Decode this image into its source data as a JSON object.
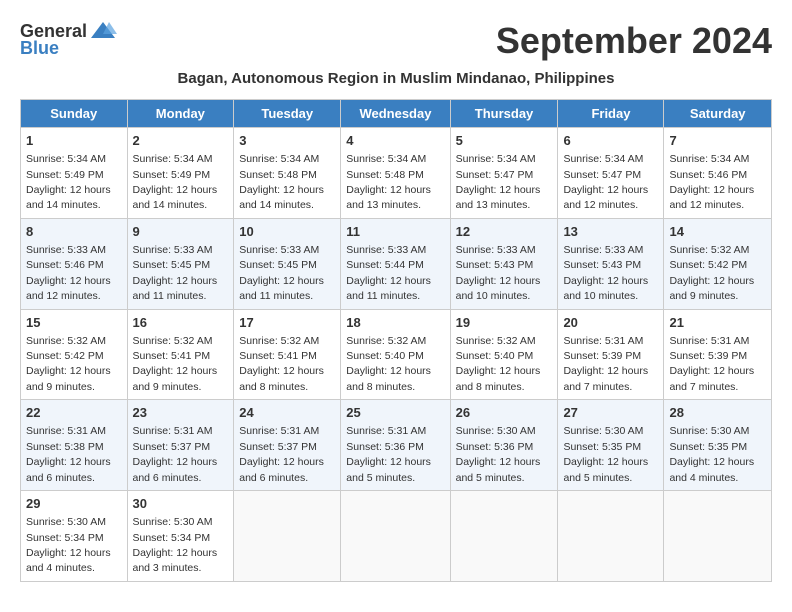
{
  "header": {
    "logo_general": "General",
    "logo_blue": "Blue",
    "month_title": "September 2024",
    "subtitle": "Bagan, Autonomous Region in Muslim Mindanao, Philippines"
  },
  "weekdays": [
    "Sunday",
    "Monday",
    "Tuesday",
    "Wednesday",
    "Thursday",
    "Friday",
    "Saturday"
  ],
  "weeks": [
    [
      {
        "day": "1",
        "sunrise": "Sunrise: 5:34 AM",
        "sunset": "Sunset: 5:49 PM",
        "daylight": "Daylight: 12 hours and 14 minutes."
      },
      {
        "day": "2",
        "sunrise": "Sunrise: 5:34 AM",
        "sunset": "Sunset: 5:49 PM",
        "daylight": "Daylight: 12 hours and 14 minutes."
      },
      {
        "day": "3",
        "sunrise": "Sunrise: 5:34 AM",
        "sunset": "Sunset: 5:48 PM",
        "daylight": "Daylight: 12 hours and 14 minutes."
      },
      {
        "day": "4",
        "sunrise": "Sunrise: 5:34 AM",
        "sunset": "Sunset: 5:48 PM",
        "daylight": "Daylight: 12 hours and 13 minutes."
      },
      {
        "day": "5",
        "sunrise": "Sunrise: 5:34 AM",
        "sunset": "Sunset: 5:47 PM",
        "daylight": "Daylight: 12 hours and 13 minutes."
      },
      {
        "day": "6",
        "sunrise": "Sunrise: 5:34 AM",
        "sunset": "Sunset: 5:47 PM",
        "daylight": "Daylight: 12 hours and 12 minutes."
      },
      {
        "day": "7",
        "sunrise": "Sunrise: 5:34 AM",
        "sunset": "Sunset: 5:46 PM",
        "daylight": "Daylight: 12 hours and 12 minutes."
      }
    ],
    [
      {
        "day": "8",
        "sunrise": "Sunrise: 5:33 AM",
        "sunset": "Sunset: 5:46 PM",
        "daylight": "Daylight: 12 hours and 12 minutes."
      },
      {
        "day": "9",
        "sunrise": "Sunrise: 5:33 AM",
        "sunset": "Sunset: 5:45 PM",
        "daylight": "Daylight: 12 hours and 11 minutes."
      },
      {
        "day": "10",
        "sunrise": "Sunrise: 5:33 AM",
        "sunset": "Sunset: 5:45 PM",
        "daylight": "Daylight: 12 hours and 11 minutes."
      },
      {
        "day": "11",
        "sunrise": "Sunrise: 5:33 AM",
        "sunset": "Sunset: 5:44 PM",
        "daylight": "Daylight: 12 hours and 11 minutes."
      },
      {
        "day": "12",
        "sunrise": "Sunrise: 5:33 AM",
        "sunset": "Sunset: 5:43 PM",
        "daylight": "Daylight: 12 hours and 10 minutes."
      },
      {
        "day": "13",
        "sunrise": "Sunrise: 5:33 AM",
        "sunset": "Sunset: 5:43 PM",
        "daylight": "Daylight: 12 hours and 10 minutes."
      },
      {
        "day": "14",
        "sunrise": "Sunrise: 5:32 AM",
        "sunset": "Sunset: 5:42 PM",
        "daylight": "Daylight: 12 hours and 9 minutes."
      }
    ],
    [
      {
        "day": "15",
        "sunrise": "Sunrise: 5:32 AM",
        "sunset": "Sunset: 5:42 PM",
        "daylight": "Daylight: 12 hours and 9 minutes."
      },
      {
        "day": "16",
        "sunrise": "Sunrise: 5:32 AM",
        "sunset": "Sunset: 5:41 PM",
        "daylight": "Daylight: 12 hours and 9 minutes."
      },
      {
        "day": "17",
        "sunrise": "Sunrise: 5:32 AM",
        "sunset": "Sunset: 5:41 PM",
        "daylight": "Daylight: 12 hours and 8 minutes."
      },
      {
        "day": "18",
        "sunrise": "Sunrise: 5:32 AM",
        "sunset": "Sunset: 5:40 PM",
        "daylight": "Daylight: 12 hours and 8 minutes."
      },
      {
        "day": "19",
        "sunrise": "Sunrise: 5:32 AM",
        "sunset": "Sunset: 5:40 PM",
        "daylight": "Daylight: 12 hours and 8 minutes."
      },
      {
        "day": "20",
        "sunrise": "Sunrise: 5:31 AM",
        "sunset": "Sunset: 5:39 PM",
        "daylight": "Daylight: 12 hours and 7 minutes."
      },
      {
        "day": "21",
        "sunrise": "Sunrise: 5:31 AM",
        "sunset": "Sunset: 5:39 PM",
        "daylight": "Daylight: 12 hours and 7 minutes."
      }
    ],
    [
      {
        "day": "22",
        "sunrise": "Sunrise: 5:31 AM",
        "sunset": "Sunset: 5:38 PM",
        "daylight": "Daylight: 12 hours and 6 minutes."
      },
      {
        "day": "23",
        "sunrise": "Sunrise: 5:31 AM",
        "sunset": "Sunset: 5:37 PM",
        "daylight": "Daylight: 12 hours and 6 minutes."
      },
      {
        "day": "24",
        "sunrise": "Sunrise: 5:31 AM",
        "sunset": "Sunset: 5:37 PM",
        "daylight": "Daylight: 12 hours and 6 minutes."
      },
      {
        "day": "25",
        "sunrise": "Sunrise: 5:31 AM",
        "sunset": "Sunset: 5:36 PM",
        "daylight": "Daylight: 12 hours and 5 minutes."
      },
      {
        "day": "26",
        "sunrise": "Sunrise: 5:30 AM",
        "sunset": "Sunset: 5:36 PM",
        "daylight": "Daylight: 12 hours and 5 minutes."
      },
      {
        "day": "27",
        "sunrise": "Sunrise: 5:30 AM",
        "sunset": "Sunset: 5:35 PM",
        "daylight": "Daylight: 12 hours and 5 minutes."
      },
      {
        "day": "28",
        "sunrise": "Sunrise: 5:30 AM",
        "sunset": "Sunset: 5:35 PM",
        "daylight": "Daylight: 12 hours and 4 minutes."
      }
    ],
    [
      {
        "day": "29",
        "sunrise": "Sunrise: 5:30 AM",
        "sunset": "Sunset: 5:34 PM",
        "daylight": "Daylight: 12 hours and 4 minutes."
      },
      {
        "day": "30",
        "sunrise": "Sunrise: 5:30 AM",
        "sunset": "Sunset: 5:34 PM",
        "daylight": "Daylight: 12 hours and 3 minutes."
      },
      null,
      null,
      null,
      null,
      null
    ]
  ]
}
